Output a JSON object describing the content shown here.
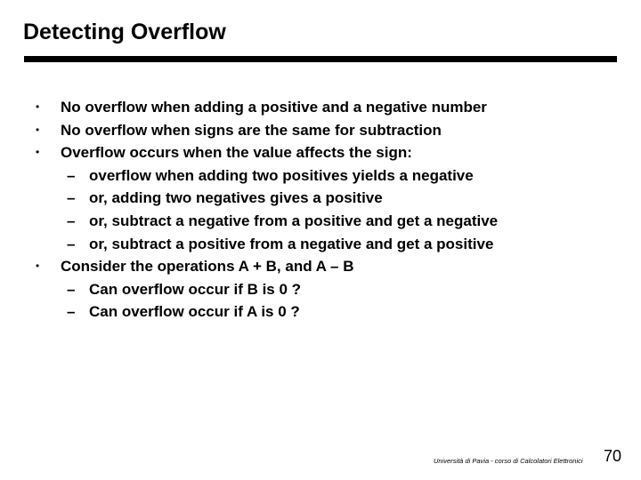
{
  "slide": {
    "title": "Detecting Overflow",
    "bullet_glyph": "•",
    "dash_glyph": "–",
    "items": [
      {
        "level": 1,
        "text": "No overflow when adding a positive and a negative number"
      },
      {
        "level": 1,
        "text": "No overflow when signs are the same for subtraction"
      },
      {
        "level": 1,
        "text": "Overflow occurs when the value affects the sign:"
      },
      {
        "level": 2,
        "text": "overflow when adding two positives yields a negative"
      },
      {
        "level": 2,
        "text": "or, adding two negatives gives a positive"
      },
      {
        "level": 2,
        "text": "or, subtract a negative from a positive and get a negative"
      },
      {
        "level": 2,
        "text": "or, subtract a positive from a negative and get a positive"
      },
      {
        "level": 1,
        "text": "Consider the operations A + B, and A – B"
      },
      {
        "level": 2,
        "text": "Can overflow occur if B is 0 ?"
      },
      {
        "level": 2,
        "text": "Can overflow occur if A is 0 ?"
      }
    ]
  },
  "footer": {
    "text": "Università di Pavia - corso di Calcolatori Elettronici",
    "page_number": "70"
  }
}
